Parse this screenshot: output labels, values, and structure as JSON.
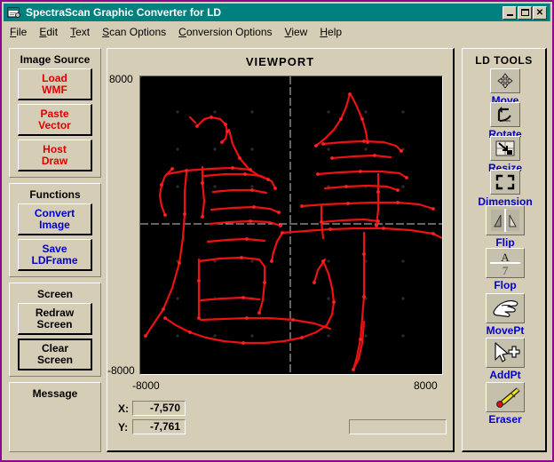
{
  "window": {
    "title": "SpectraScan Graphic Converter for LD",
    "icon": "app-window-icon",
    "controls": {
      "minimize": "_",
      "maximize": "□",
      "close": "✕"
    },
    "titlebar_color": "#00807e",
    "frame_color": "#8b0a8b",
    "face_color": "#d6cdb7"
  },
  "menu": {
    "items": [
      {
        "label": "File",
        "accel": "F"
      },
      {
        "label": "Edit",
        "accel": "E"
      },
      {
        "label": "Text",
        "accel": "T"
      },
      {
        "label": "Scan Options",
        "accel": "S"
      },
      {
        "label": "Conversion Options",
        "accel": "C"
      },
      {
        "label": "View",
        "accel": "V"
      },
      {
        "label": "Help",
        "accel": "H"
      }
    ]
  },
  "image_source": {
    "title": "Image Source",
    "color": "#e00000",
    "buttons": [
      {
        "line1": "Load",
        "line2": "WMF"
      },
      {
        "line1": "Paste",
        "line2": "Vector"
      },
      {
        "line1": "Host",
        "line2": "Draw"
      }
    ]
  },
  "functions": {
    "title": "Functions",
    "color": "#0000cc",
    "buttons": [
      {
        "line1": "Convert",
        "line2": "Image"
      },
      {
        "line1": "Save",
        "line2": "LDFrame"
      }
    ]
  },
  "screen": {
    "title": "Screen",
    "color": "#000000",
    "buttons": [
      {
        "line1": "Redraw",
        "line2": "Screen",
        "default": false
      },
      {
        "line1": "Clear",
        "line2": "Screen",
        "default": true
      }
    ]
  },
  "message": {
    "title": "Message",
    "text": ""
  },
  "viewport": {
    "title": "VIEWPORT",
    "background": "#000000",
    "trace_color": "#ee0000",
    "axis_color": "#c0c0c0",
    "y_max_label": "8000",
    "y_min_label": "-8000",
    "x_min_label": "-8000",
    "x_max_label": "8000",
    "content_description": "Two Chinese characters traced as red point-polylines: 虎 (left) and 年 (right)"
  },
  "coords": {
    "x_label": "X:",
    "x_value": "-7,570",
    "y_label": "Y:",
    "y_value": "-7,761"
  },
  "status": {
    "text": ""
  },
  "tools": {
    "title": "LD TOOLS",
    "label_color": "#0000cc",
    "items": [
      {
        "label": "Move",
        "icon": "four-way-arrow-icon"
      },
      {
        "label": "Rotate",
        "icon": "rotate-arrow-icon"
      },
      {
        "label": "Resize",
        "icon": "resize-arrow-icon"
      },
      {
        "label": "Dimension",
        "icon": "dimension-corners-icon"
      },
      {
        "label": "Flip",
        "icon": "flip-horizontal-icon"
      },
      {
        "label": "Flop",
        "icon": "flop-vertical-icon"
      },
      {
        "label": "MovePt",
        "icon": "hand-point-icon"
      },
      {
        "label": "AddPt",
        "icon": "cursor-plus-icon"
      },
      {
        "label": "Eraser",
        "icon": "eraser-pencil-icon"
      }
    ]
  }
}
